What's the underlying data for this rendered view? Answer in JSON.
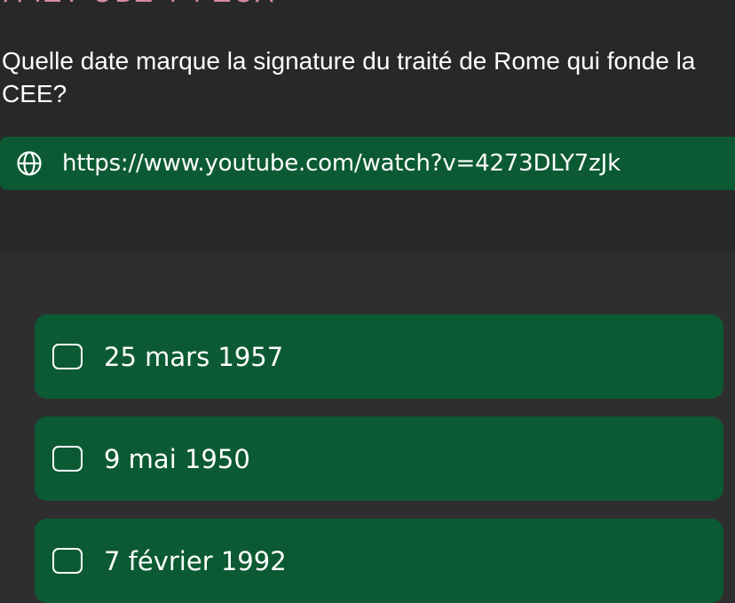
{
  "header": {
    "partial_text": "A IZT OBZ T I ZOA"
  },
  "question": {
    "text": "Quelle date marque la signature du traité de Rome qui fonde la CEE?"
  },
  "link": {
    "icon": "globe-icon",
    "url": "https://www.youtube.com/watch?v=4273DLY7zJk"
  },
  "options": [
    {
      "label": "25 mars 1957",
      "checked": false
    },
    {
      "label": "9 mai 1950",
      "checked": false
    },
    {
      "label": "7 février 1992",
      "checked": false
    }
  ],
  "colors": {
    "background_top": "#28282a",
    "background_bottom": "#2e2e2f",
    "accent_green": "#0c5a33",
    "header_pink": "#d58aa7"
  }
}
